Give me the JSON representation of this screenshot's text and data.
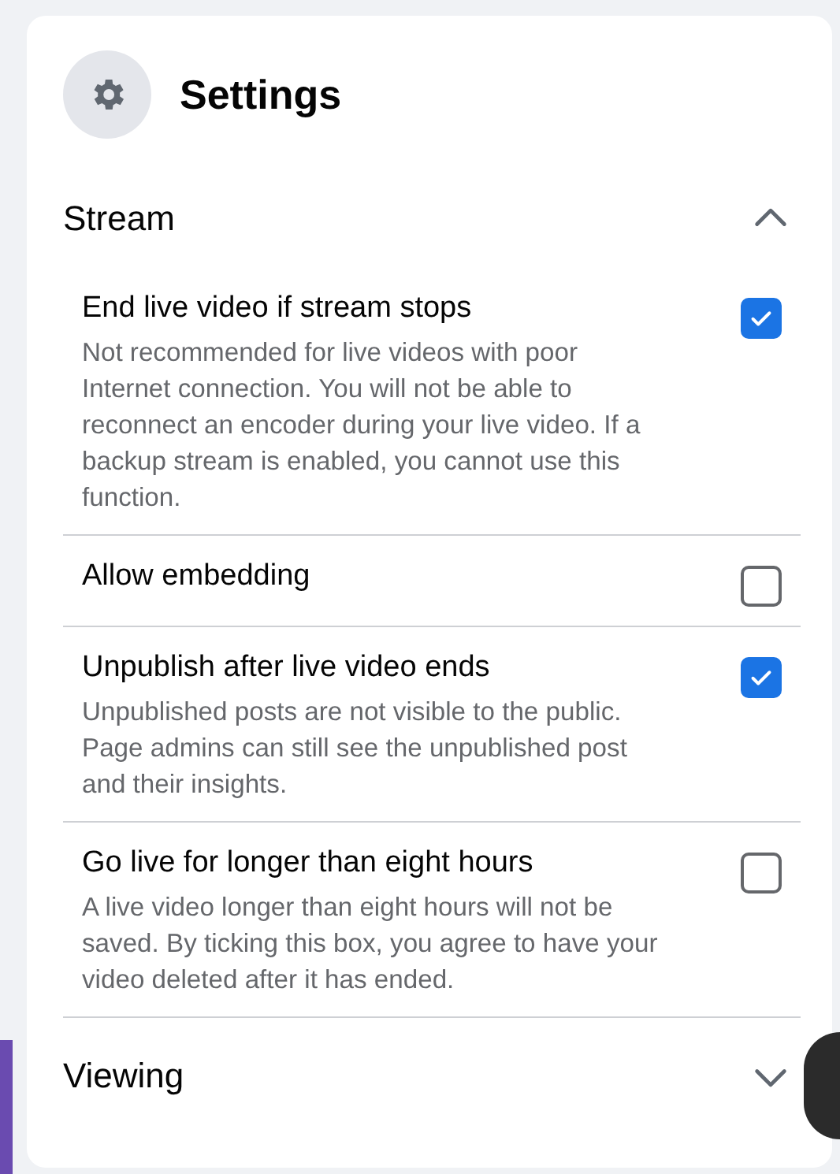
{
  "header": {
    "title": "Settings"
  },
  "sections": [
    {
      "title": "Stream",
      "expanded": true,
      "items": [
        {
          "title": "End live video if stream stops",
          "description": "Not recommended for live videos with poor Internet connection. You will not be able to reconnect an encoder during your live video. If a backup stream is enabled, you cannot use this function.",
          "checked": true
        },
        {
          "title": "Allow embedding",
          "checked": false
        },
        {
          "title": "Unpublish after live video ends",
          "description": "Unpublished posts are not visible to the public. Page admins can still see the unpublished post and their insights.",
          "checked": true
        },
        {
          "title": "Go live for longer than eight hours",
          "description": "A live video longer than eight hours will not be saved. By ticking this box, you agree to have your video deleted after it has ended.",
          "checked": false
        }
      ]
    },
    {
      "title": "Viewing",
      "expanded": false
    }
  ]
}
